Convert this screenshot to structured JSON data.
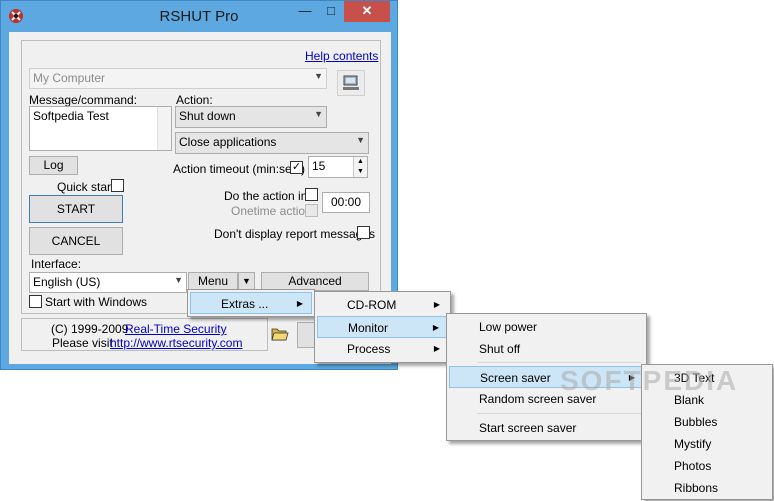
{
  "window": {
    "title": "RSHUT Pro",
    "minimize_glyph": "—",
    "maximize_glyph": "□",
    "close_glyph": "✕"
  },
  "help_link": "Help contents",
  "computer": {
    "value": "My Computer"
  },
  "message": {
    "label": "Message/command:",
    "value": "Softpedia Test"
  },
  "action": {
    "label": "Action:",
    "value": "Shut down",
    "mode": "Close applications"
  },
  "timeout": {
    "label": "Action timeout (min:sec.)",
    "checked": true,
    "check_glyph": "✓",
    "value": "15"
  },
  "log_button": "Log",
  "quick_start": {
    "label": "Quick start",
    "checked": false
  },
  "do_action_in": {
    "label": "Do the action in:",
    "value": "00:00"
  },
  "onetime_action": {
    "label": "Onetime action"
  },
  "start_button": "START",
  "cancel_button": "CANCEL",
  "dont_display": {
    "label": "Don't display report messages"
  },
  "interface": {
    "label": "Interface:",
    "value": "English (US)"
  },
  "menu_button": "Menu",
  "advanced_button": "Advanced",
  "start_with_windows": {
    "label": "Start with Windows"
  },
  "footer": {
    "copyright": "(C) 1999-2009",
    "company_link": "Real-Time Security",
    "visit_prefix": "Please visit",
    "url_link": "http://www.rtsecurity.com"
  },
  "menus": {
    "main": [
      "Extras ..."
    ],
    "extras": [
      "CD-ROM",
      "Monitor",
      "Process"
    ],
    "monitor": [
      "Low power",
      "Shut off",
      "Screen saver",
      "Random screen saver",
      "Start screen saver"
    ],
    "screen_saver": [
      "3D Text",
      "Blank",
      "Bubbles",
      "Mystify",
      "Photos",
      "Ribbons"
    ]
  },
  "watermark": "SOFTPEDIA",
  "icons": [
    "app-logo-icon",
    "computer-browse-icon",
    "open-folder-icon",
    "submenu-arrow-icon",
    "dropdown-arrow-icon"
  ],
  "colors": {
    "title_bar": "#5da8e0",
    "close_button": "#c7504a",
    "menu_highlight": "#cde6f7",
    "link": "#0000cc"
  }
}
